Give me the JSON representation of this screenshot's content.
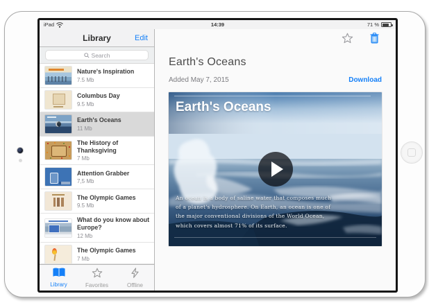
{
  "status_bar": {
    "carrier": "iPad",
    "time": "14:39",
    "battery_label": "71 %",
    "battery_percent": 71
  },
  "sidebar": {
    "title": "Library",
    "edit_label": "Edit",
    "search_placeholder": "Search",
    "items": [
      {
        "title": "Nature's Inspiration",
        "size": "7.5 Mb",
        "selected": false
      },
      {
        "title": "Columbus Day",
        "size": "9.5 Mb",
        "selected": false
      },
      {
        "title": "Earth's Oceans",
        "size": "11 Mb",
        "selected": true
      },
      {
        "title": "The History of Thanksgiving",
        "size": "7 Mb",
        "selected": false
      },
      {
        "title": "Attention Grabber",
        "size": "7,5 Mb",
        "selected": false
      },
      {
        "title": "The Olympic Games",
        "size": "9.5 Mb",
        "selected": false
      },
      {
        "title": "What do you know about Europe?",
        "size": "12 Mb",
        "selected": false
      },
      {
        "title": "The Olympic Games",
        "size": "7 Mb",
        "selected": false
      }
    ],
    "tabs": [
      {
        "label": "Library",
        "icon": "book-icon",
        "active": true
      },
      {
        "label": "Favorites",
        "icon": "star-icon",
        "active": false
      },
      {
        "label": "Offline",
        "icon": "lightning-icon",
        "active": false
      }
    ]
  },
  "content": {
    "title": "Earth's Oceans",
    "added_label": "Added May 7, 2015",
    "download_label": "Download",
    "toolbar_icons": [
      "favorite-star-icon",
      "trash-icon"
    ],
    "video": {
      "slide_title": "Earth's Oceans",
      "play_icon": "play-icon",
      "caption_lines": [
        "An ocean is a body of saline water that composes much",
        "of a planet's hydrosphere. On Earth, an ocean is one of",
        "the major conventional divisions of the World Ocean,",
        "which covers almost 71% of its surface."
      ]
    }
  },
  "colors": {
    "accent": "#1580f8",
    "selected_row": "#d9d9d9",
    "slide_sky": "#4d7dae",
    "slide_sea_dark": "#152e4a"
  }
}
